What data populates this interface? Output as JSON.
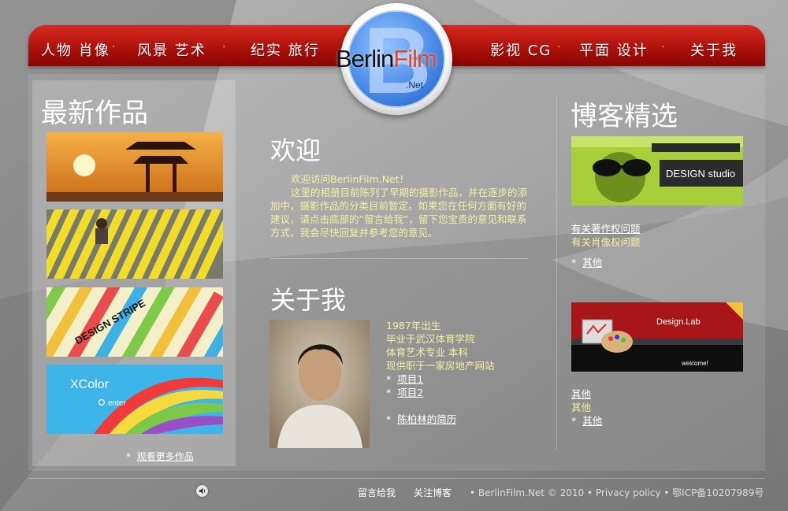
{
  "nav": {
    "items": [
      "人物 肖像",
      "风景 艺术",
      "纪实 旅行",
      "影视 CG",
      "平面 设计",
      "关于我"
    ],
    "separator": "·"
  },
  "logo": {
    "name_part1": "Berlin",
    "name_part2": "Film",
    "suffix": ".Net",
    "letter": "B"
  },
  "left": {
    "title": "最新作品",
    "more_bullet": "*",
    "more_link": "观看更多作品"
  },
  "welcome": {
    "title": "欢迎",
    "greeting": "欢迎访问BerlinFilm.Net！",
    "body": "这里的相册目前陈列了早期的摄影作品，并在逐步的添加中，摄影作品的分类目前暂定。如果您在任何方面有好的建议，请点击底部的“留言给我”，留下您宝贵的意见和联系方式，我会尽快回复并参考您的意见。"
  },
  "about": {
    "title": "关于我",
    "lines": [
      "1987年出生",
      "毕业于武汉体育学院",
      "体育艺术专业 本科",
      "现供职于一家房地产网站"
    ],
    "bullet": "*",
    "links": [
      "项目1",
      "项目2",
      "陈柏林的简历"
    ]
  },
  "blog": {
    "title": "博客精选",
    "group1": {
      "link1": "有关著作权问题",
      "text1": "有关肖像权问题",
      "link2": "其他"
    },
    "group2": {
      "link1": "其他",
      "text1": "其他",
      "link2": "其他"
    },
    "img1_label": "DESIGN studio",
    "img2_label": "Design.Lab",
    "img2_welcome": "welcome!"
  },
  "thumbs": {
    "xcolor": "XColor",
    "enter": "enter",
    "stripe": "DESIGN STRIPE"
  },
  "footer": {
    "guestbook": "留言给我",
    "follow_blog": "关注博客",
    "copyright": "• BerlinFilm.Net © 2010 • Privacy policy • 鄂ICP备10207989号"
  },
  "colors": {
    "nav_red": "#c2150e",
    "body_text": "#f3f0a2",
    "background": "#8d8d8d"
  }
}
